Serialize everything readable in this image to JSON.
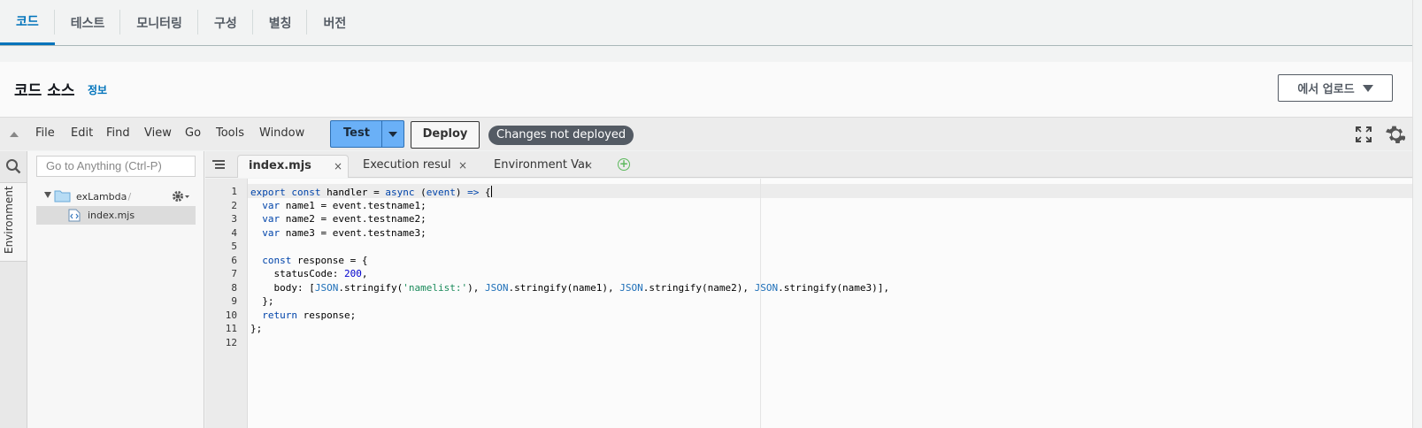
{
  "top_tabs": [
    {
      "label": "코드",
      "active": true
    },
    {
      "label": "테스트"
    },
    {
      "label": "모니터링"
    },
    {
      "label": "구성"
    },
    {
      "label": "별칭"
    },
    {
      "label": "버전"
    }
  ],
  "panel": {
    "title": "코드 소스",
    "info_link": "정보",
    "upload_button": "에서 업로드"
  },
  "menubar": {
    "items": [
      "File",
      "Edit",
      "Find",
      "View",
      "Go",
      "Tools",
      "Window"
    ],
    "test_button": "Test",
    "deploy_button": "Deploy",
    "status_badge": "Changes not deployed"
  },
  "sidebar": {
    "search_placeholder": "Go to Anything (Ctrl-P)",
    "environment_tab": "Environment",
    "folder": "exLambda",
    "folder_suffix": "- /",
    "file": "index.mjs"
  },
  "editor_tabs": [
    {
      "label": "index.mjs",
      "active": true
    },
    {
      "label": "Execution results"
    },
    {
      "label": "Environment Vari"
    }
  ],
  "editor": {
    "line_numbers": [
      "1",
      "2",
      "3",
      "4",
      "5",
      "6",
      "7",
      "8",
      "9",
      "10",
      "11",
      "12"
    ],
    "active_line": 1
  },
  "colors": {
    "accent": "#0073bb",
    "test_button": "#6ab0f7",
    "badge": "#545b64"
  }
}
